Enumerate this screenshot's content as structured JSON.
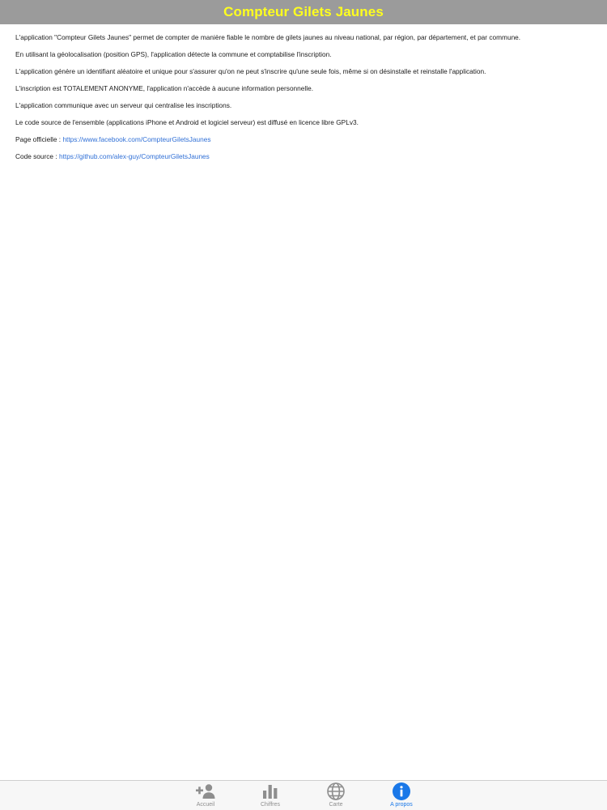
{
  "header": {
    "title": "Compteur Gilets Jaunes"
  },
  "content": {
    "paragraphs": [
      "L'application \"Compteur Gilets Jaunes\" permet de compter de manière fiable le nombre de gilets jaunes au niveau national, par région, par département, et par commune.",
      "En utilisant la géolocalisation (position GPS), l'application détecte la commune et comptabilise l'inscription.",
      "L'application génère un identifiant aléatoire et unique pour s'assurer qu'on ne peut s'inscrire qu'une seule fois, même si on désinstalle et reinstalle l'application.",
      "L'inscription est TOTALEMENT ANONYME, l'application n'accède à aucune information personnelle.",
      "L'application communique avec un serveur qui centralise  les inscriptions.",
      "Le code source de l'ensemble (applications iPhone et Android et logiciel serveur) est diffusé en licence libre GPLv3."
    ],
    "official_page": {
      "label": "Page officielle : ",
      "url": "https://www.facebook.com/CompteurGiletsJaunes"
    },
    "source_code": {
      "label": "Code source : ",
      "url": "https://github.com/alex-guy/CompteurGiletsJaunes"
    }
  },
  "tab_bar": {
    "tabs": [
      {
        "label": "Accueil",
        "icon": "add-user-icon",
        "active": false
      },
      {
        "label": "Chiffres",
        "icon": "bar-chart-icon",
        "active": false
      },
      {
        "label": "Carte",
        "icon": "globe-icon",
        "active": false
      },
      {
        "label": "A propos",
        "icon": "info-icon",
        "active": true
      }
    ]
  },
  "colors": {
    "header_bg": "#9b9b9b",
    "header_title": "#ffff1e",
    "link": "#2f6fd6",
    "tab_active": "#1a78e8",
    "tab_inactive": "#8e8e8e"
  }
}
